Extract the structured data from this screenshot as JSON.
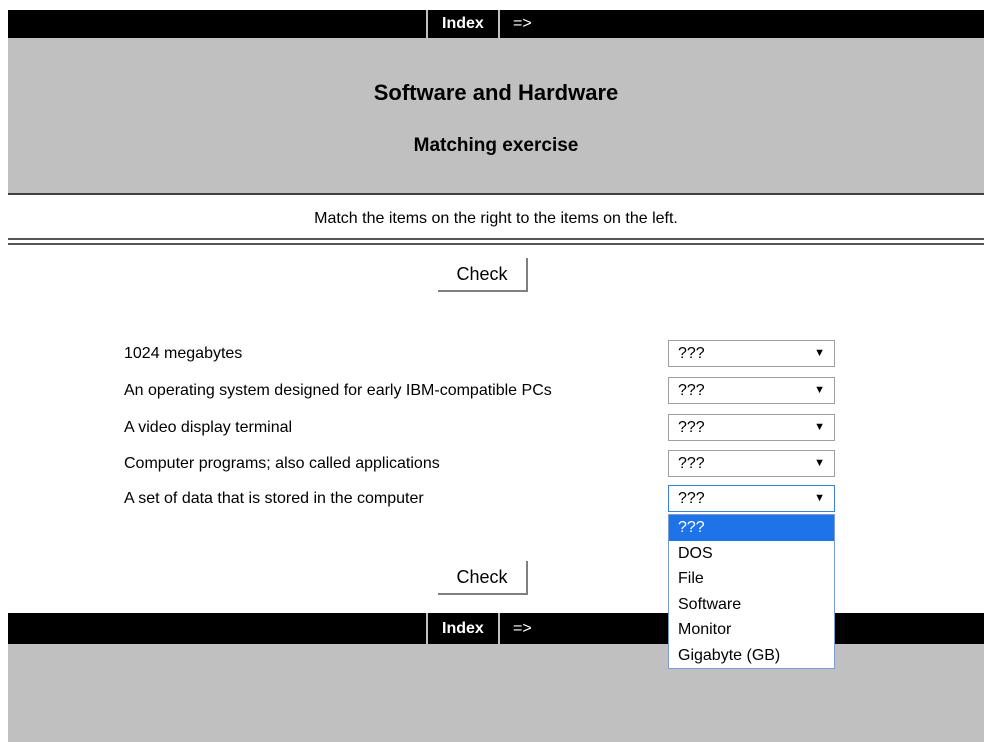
{
  "nav": {
    "index_label": "Index",
    "next_label": "=>"
  },
  "header": {
    "title": "Software and Hardware",
    "subtitle": "Matching exercise"
  },
  "instructions": "Match the items on the right to the items on the left.",
  "check_label": "Check",
  "items": [
    {
      "label": "1024 megabytes",
      "value": "???"
    },
    {
      "label": "An operating system designed for early IBM-compatible PCs",
      "value": "???"
    },
    {
      "label": "A video display terminal",
      "value": "???"
    },
    {
      "label": "Computer programs; also called applications",
      "value": "???"
    },
    {
      "label": "A set of data that is stored in the computer",
      "value": "???"
    }
  ],
  "dropdown": {
    "open_for_item": 5,
    "options": [
      "???",
      "DOS",
      "File",
      "Software",
      "Monitor",
      "Gigabyte (GB)"
    ],
    "selected_option": "???"
  },
  "colors": {
    "nav_background": "#000000",
    "band_background": "#c0c0c0",
    "selection_highlight": "#1e73e8"
  },
  "icons": {
    "select_arrow": "dropdown-arrow-icon"
  }
}
